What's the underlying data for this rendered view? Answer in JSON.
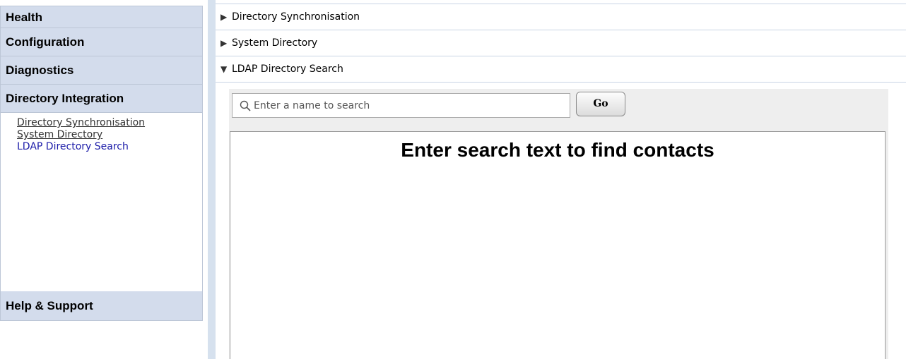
{
  "nav": {
    "headers": [
      "Health",
      "Configuration",
      "Diagnostics",
      "Directory Integration"
    ],
    "sub_items": [
      "Directory Synchronisation",
      "System Directory",
      "LDAP Directory Search"
    ],
    "footer": "Help & Support"
  },
  "sections": {
    "items": [
      "Directory Synchronisation",
      "System Directory",
      "LDAP Directory Search"
    ]
  },
  "search": {
    "placeholder": "Enter a name to search",
    "go_label": "Go",
    "empty_message": "Enter search text to find contacts"
  },
  "icons": {
    "collapsed": "triangle-right-icon",
    "expanded": "triangle-down-icon",
    "search": "magnifier-icon"
  },
  "colors": {
    "nav_bg": "#d3dcec",
    "active_link": "#1a1aa8",
    "strip": "#d6e1ee"
  }
}
